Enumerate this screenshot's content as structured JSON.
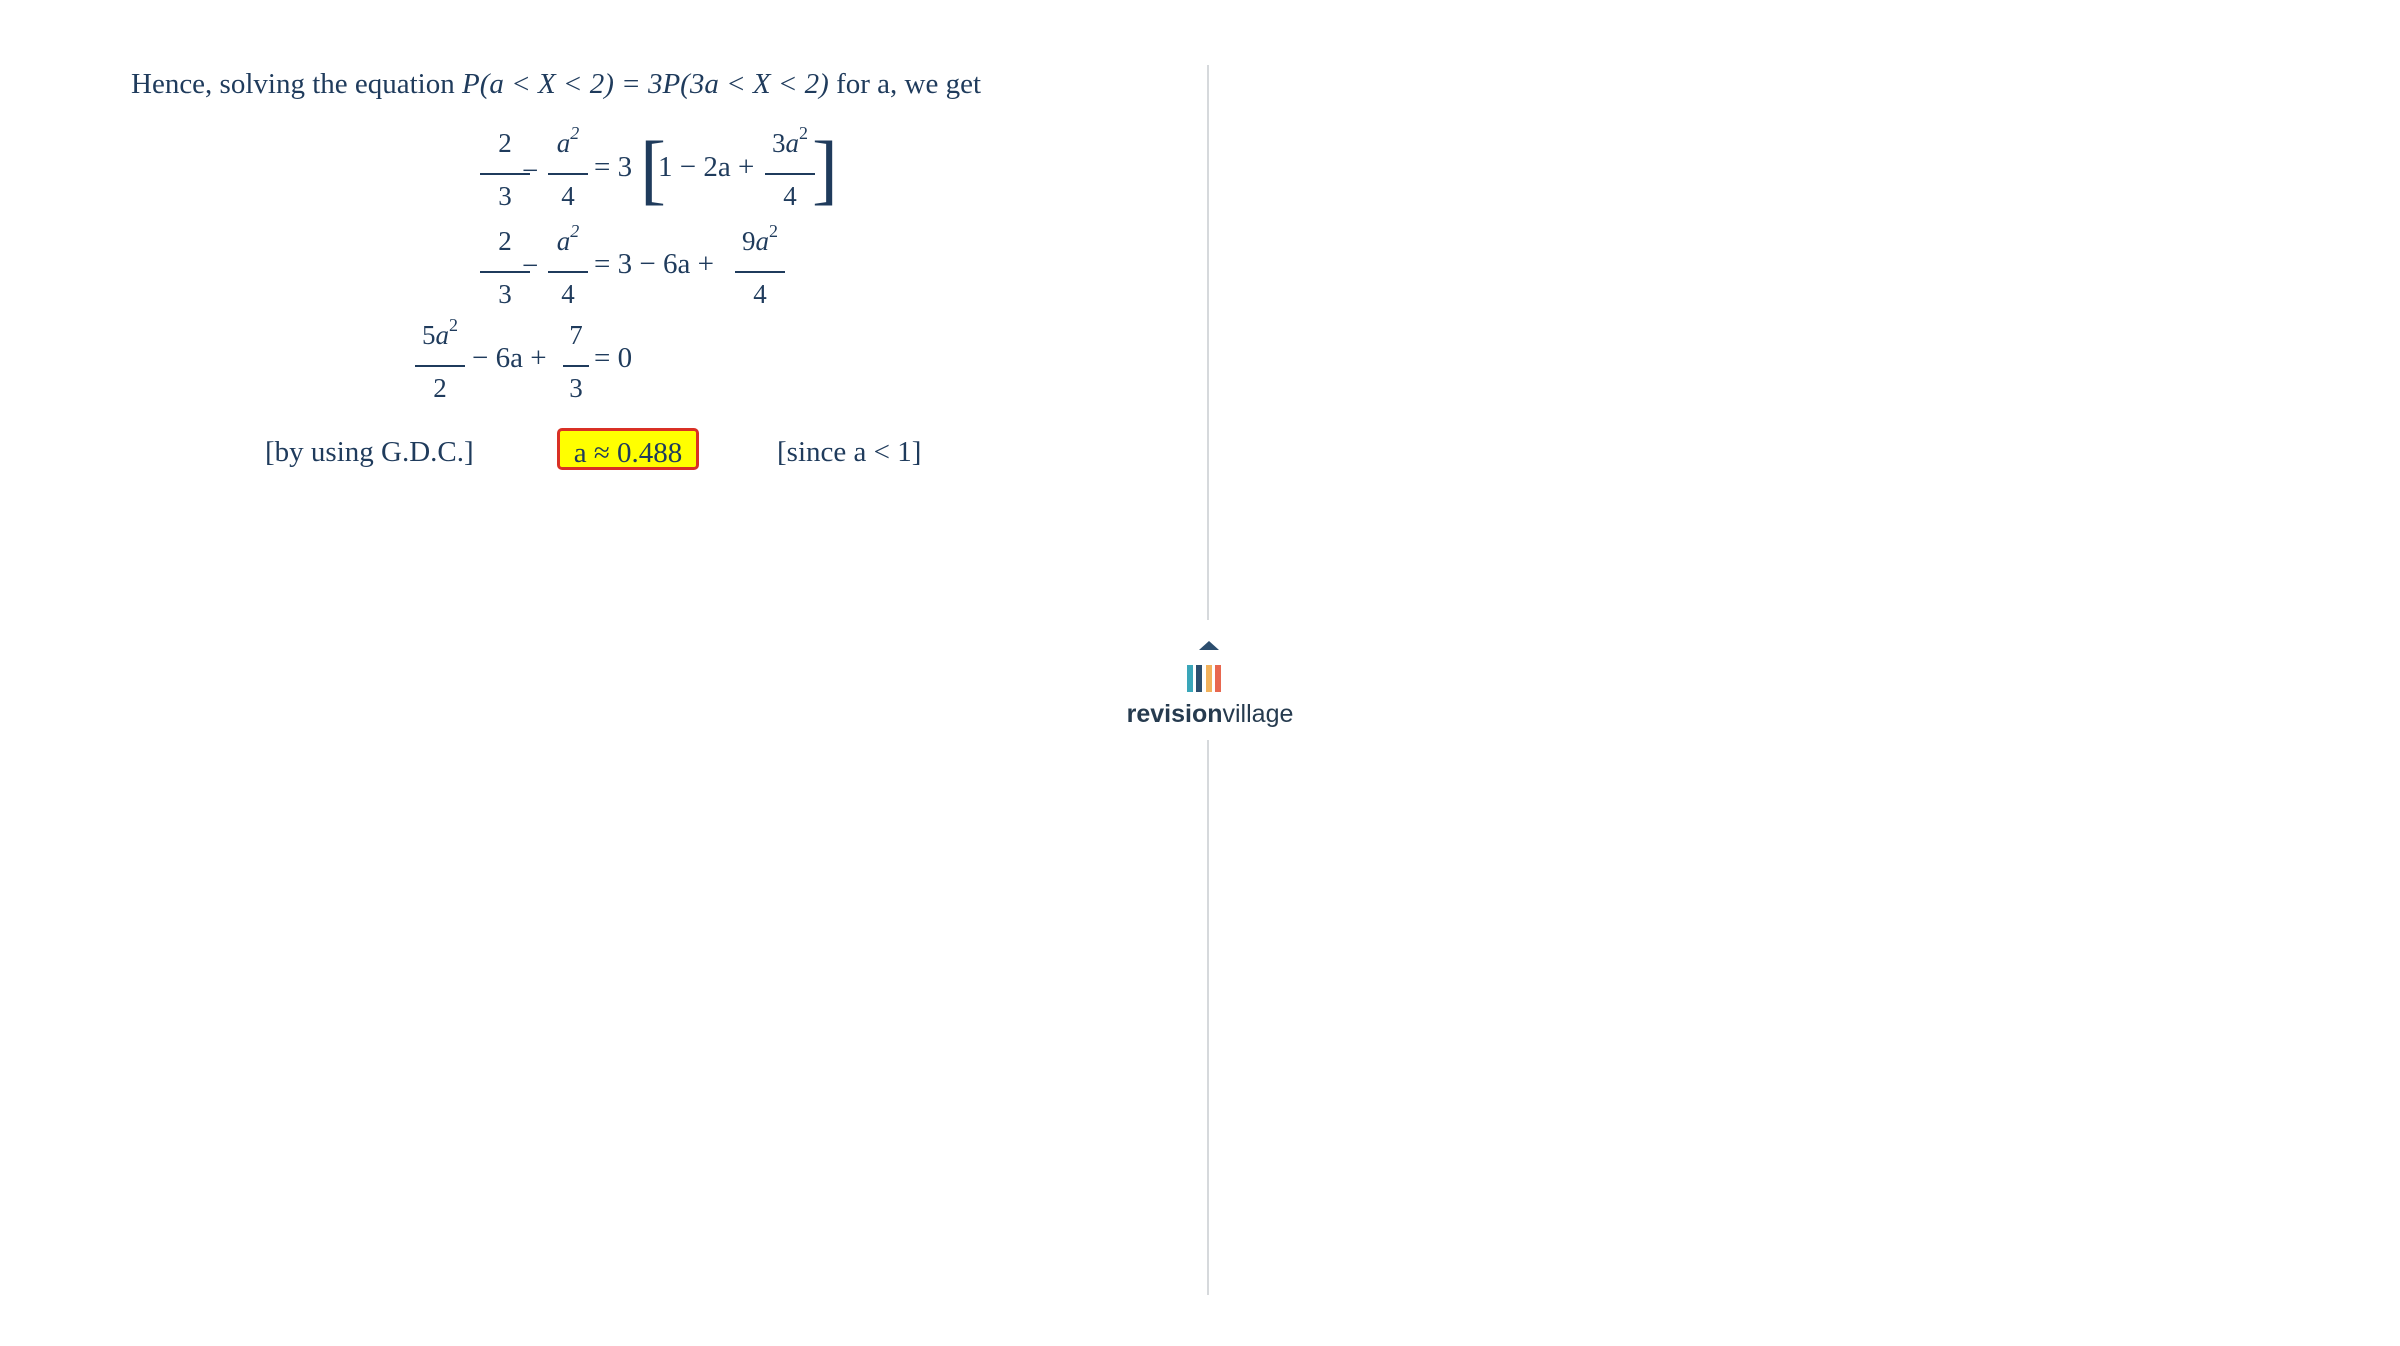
{
  "intro": {
    "prefix": "Hence, solving the equation ",
    "equation": "P(a < X < 2) = 3P(3a < X < 2)",
    "suffix": " for a, we get"
  },
  "line1": {
    "f1": {
      "num": "2",
      "den": "3"
    },
    "op1": "−",
    "f2": {
      "num": "a2",
      "den": "4"
    },
    "eq": "= 3",
    "open": "[",
    "mid": "1 − 2a +",
    "f3": {
      "num": "3a2",
      "den": "4"
    },
    "close": "]"
  },
  "line2": {
    "f1": {
      "num": "2",
      "den": "3"
    },
    "op1": "−",
    "f2": {
      "num": "a2",
      "den": "4"
    },
    "mid": "= 3 − 6a +",
    "f3": {
      "num": "9a2",
      "den": "4"
    }
  },
  "line3": {
    "f1": {
      "num": "5a2",
      "den": "2"
    },
    "mid": "− 6a +",
    "f2": {
      "num": "7",
      "den": "3"
    },
    "end": "= 0"
  },
  "result": {
    "left_note": "[by using G.D.C.]",
    "answer": "a ≈ 0.488",
    "right_note": "[since a < 1]"
  },
  "brand": {
    "bold": "revision",
    "light": "village"
  },
  "colors": {
    "text": "#1f3b5c",
    "highlight_fill": "#ffff00",
    "highlight_border": "#d93025",
    "logo_bars": [
      "#3aa6b9",
      "#2c4e6e",
      "#f2b25c",
      "#e8674f"
    ]
  }
}
